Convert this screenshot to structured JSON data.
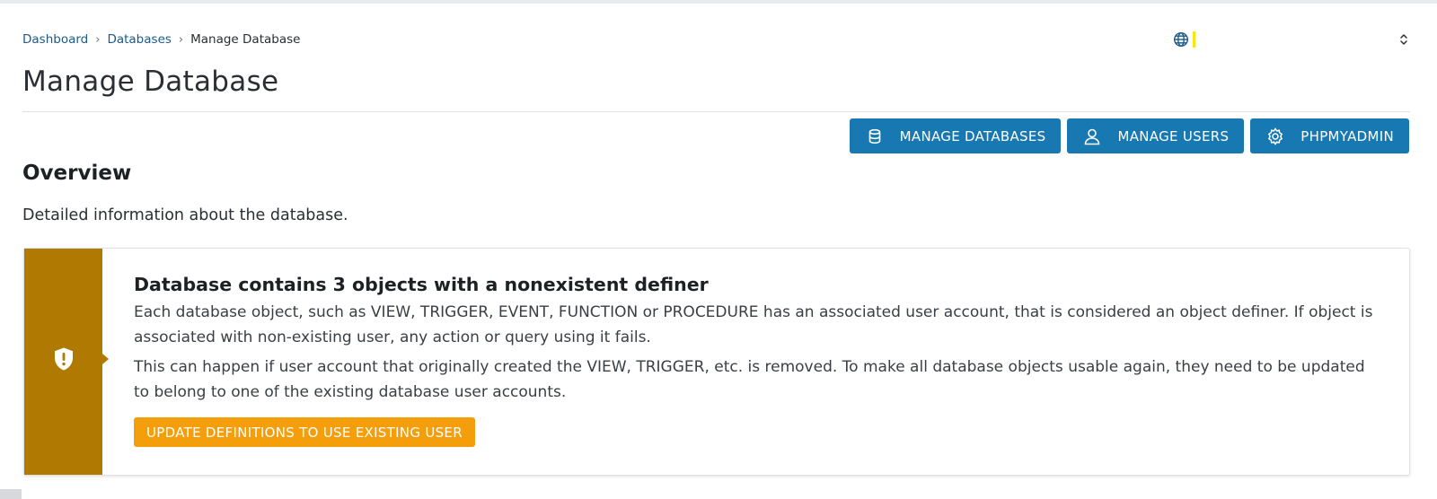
{
  "breadcrumb": {
    "items": [
      "Dashboard",
      "Databases"
    ],
    "current": "Manage Database",
    "separator": "›"
  },
  "site_selector": {
    "icon": "globe-icon",
    "value": "",
    "chevron_icon": "chevron-up-down-icon"
  },
  "page": {
    "title": "Manage Database"
  },
  "toolbar": {
    "manage_databases": "MANAGE DATABASES",
    "manage_users": "MANAGE USERS",
    "phpmyadmin": "PHPMYADMIN"
  },
  "overview": {
    "title": "Overview",
    "description": "Detailed information about the database."
  },
  "alert": {
    "icon": "shield-exclamation-icon",
    "title": "Database contains 3 objects with a nonexistent definer",
    "paragraph1": "Each database object, such as VIEW, TRIGGER, EVENT, FUNCTION or PROCEDURE has an associated user account, that is considered an object definer. If object is associated with non-existing user, any action or query using it fails.",
    "paragraph2": "This can happen if user account that originally created the VIEW, TRIGGER, etc. is removed. To make all database objects usable again, they need to be updated to belong to one of the existing database user accounts.",
    "button": "UPDATE DEFINITIONS TO USE EXISTING USER"
  },
  "colors": {
    "primary": "#1878b2",
    "warning_stripe": "#b07a02",
    "warning_button": "#f59e0b",
    "link": "#1b5a8a"
  }
}
